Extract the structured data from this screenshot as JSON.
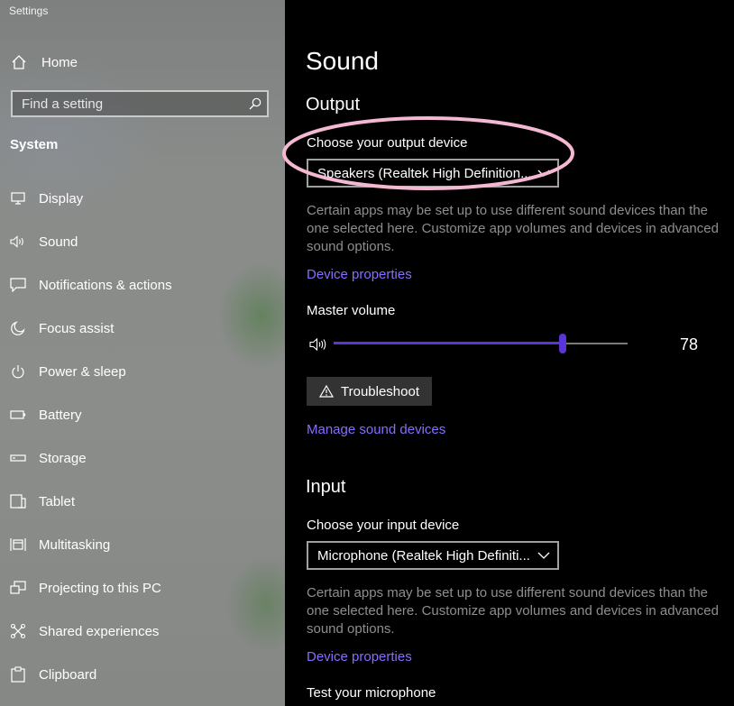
{
  "window": {
    "title": "Settings"
  },
  "sidebar": {
    "home_label": "Home",
    "search_placeholder": "Find a setting",
    "section": "System",
    "items": [
      {
        "label": "Display",
        "icon": "display-icon"
      },
      {
        "label": "Sound",
        "icon": "speaker-icon"
      },
      {
        "label": "Notifications & actions",
        "icon": "notification-icon"
      },
      {
        "label": "Focus assist",
        "icon": "moon-icon"
      },
      {
        "label": "Power & sleep",
        "icon": "power-icon"
      },
      {
        "label": "Battery",
        "icon": "battery-icon"
      },
      {
        "label": "Storage",
        "icon": "storage-icon"
      },
      {
        "label": "Tablet",
        "icon": "tablet-icon"
      },
      {
        "label": "Multitasking",
        "icon": "multitasking-icon"
      },
      {
        "label": "Projecting to this PC",
        "icon": "projecting-icon"
      },
      {
        "label": "Shared experiences",
        "icon": "shared-experiences-icon"
      },
      {
        "label": "Clipboard",
        "icon": "clipboard-icon"
      }
    ]
  },
  "main": {
    "title": "Sound",
    "output": {
      "heading": "Output",
      "device_label": "Choose your output device",
      "device_value": "Speakers (Realtek High Definition...",
      "description": "Certain apps may be set up to use different sound devices than the one selected here. Customize app volumes and devices in advanced sound options.",
      "device_properties_link": "Device properties",
      "volume_label": "Master volume",
      "volume_value": 78,
      "volume_text": "78",
      "troubleshoot_label": "Troubleshoot",
      "manage_link": "Manage sound devices"
    },
    "input": {
      "heading": "Input",
      "device_label": "Choose your input device",
      "device_value": "Microphone (Realtek High Definiti...",
      "description": "Certain apps may be set up to use different sound devices than the one selected here. Customize app volumes and devices in advanced sound options.",
      "device_properties_link": "Device properties",
      "test_label": "Test your microphone"
    }
  },
  "colors": {
    "accent": "#5a35d8",
    "link": "#8a6cff",
    "annotation": "#f4b8d2"
  }
}
